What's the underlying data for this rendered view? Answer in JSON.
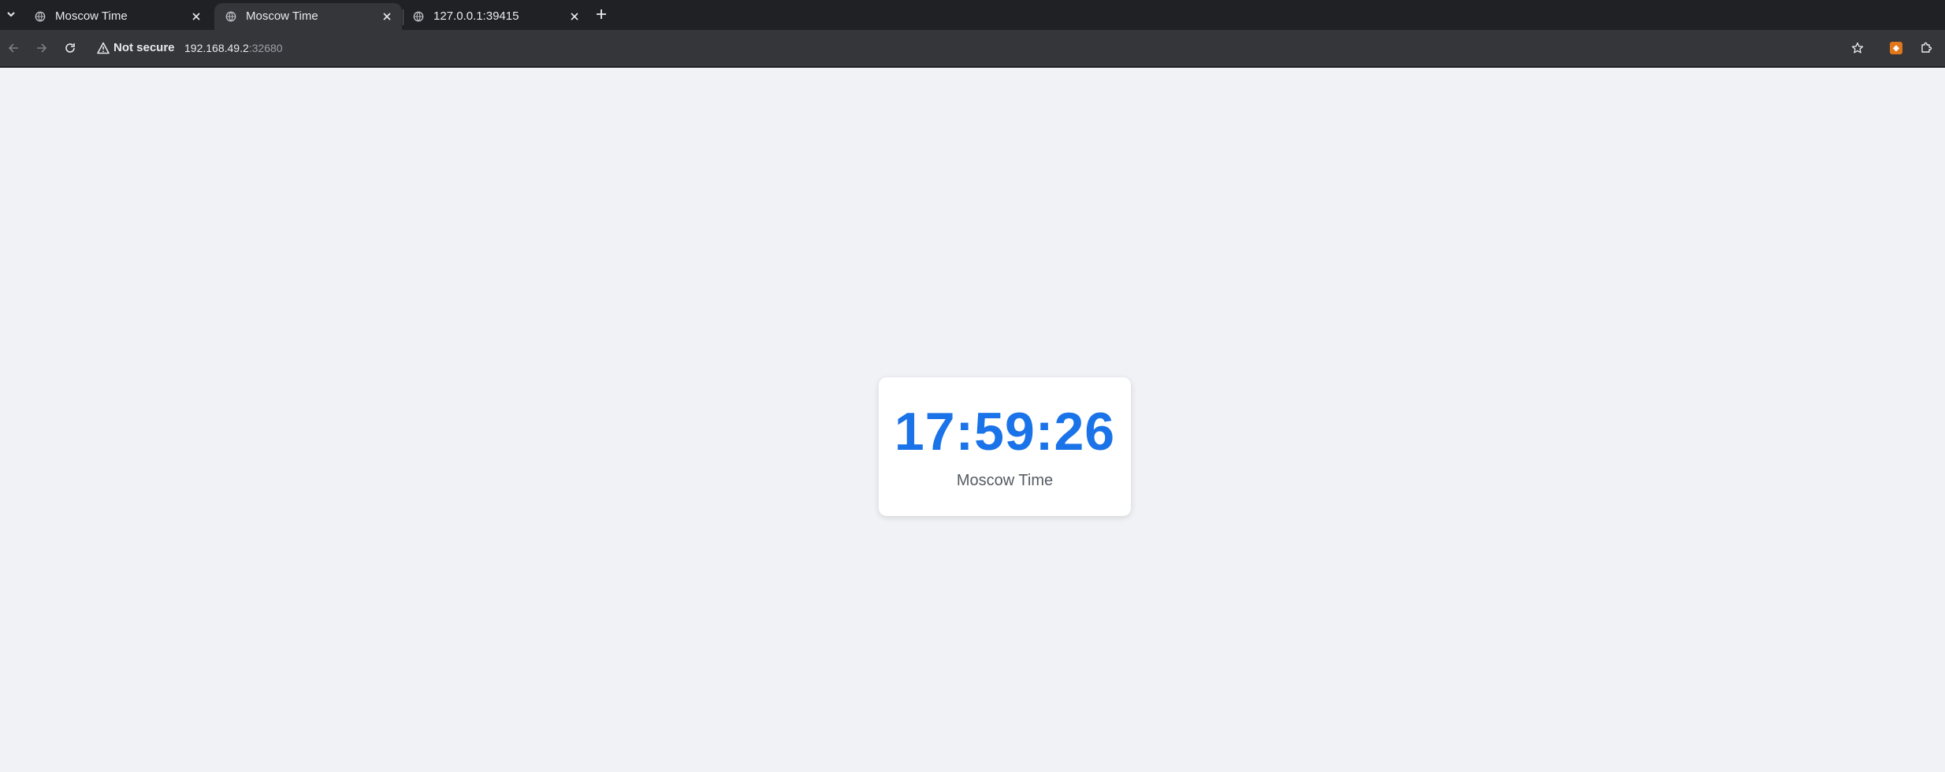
{
  "browser": {
    "tabs": [
      {
        "title": "Moscow Time",
        "icon": "globe-icon",
        "active": false
      },
      {
        "title": "Moscow Time",
        "icon": "globe-icon",
        "active": true
      },
      {
        "title": "127.0.0.1:39415",
        "icon": "globe-icon",
        "active": false
      }
    ],
    "omnibox": {
      "security_label": "Not secure",
      "url_host": "192.168.49.2",
      "url_port": ":32680"
    }
  },
  "page": {
    "time": "17:59:26",
    "caption": "Moscow Time"
  },
  "colors": {
    "time_accent": "#1a73e8",
    "page_background": "#f0f2f5",
    "tabstrip_background": "#202124",
    "toolbar_background": "#35363a"
  }
}
